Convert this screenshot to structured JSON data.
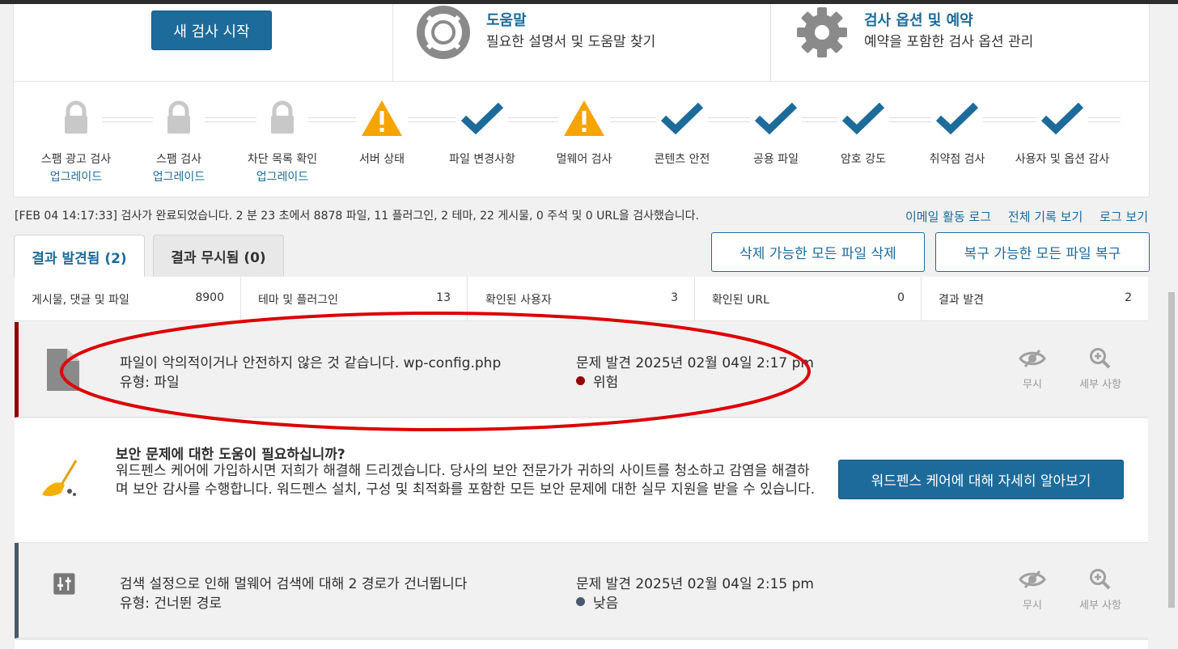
{
  "top": {
    "new_scan_label": "새 검사 시작",
    "help": {
      "title": "도움말",
      "subtitle": "필요한 설명서 및 도움말 찾기"
    },
    "options": {
      "title": "검사 옵션 및 예약",
      "subtitle": "예약을 포함한 검사 옵션 관리"
    }
  },
  "steps": [
    {
      "label": "스팸 광고 검사",
      "upgrade": "업그레이드",
      "status": "locked"
    },
    {
      "label": "스팸 검사",
      "upgrade": "업그레이드",
      "status": "locked"
    },
    {
      "label": "차단 목록 확인",
      "upgrade": "업그레이드",
      "status": "locked"
    },
    {
      "label": "서버 상태",
      "status": "warning"
    },
    {
      "label": "파일 변경사항",
      "status": "ok"
    },
    {
      "label": "멀웨어 검사",
      "status": "warning"
    },
    {
      "label": "콘텐츠 안전",
      "status": "ok"
    },
    {
      "label": "공용 파일",
      "status": "ok"
    },
    {
      "label": "암호 강도",
      "status": "ok"
    },
    {
      "label": "취약점 검사",
      "status": "ok"
    },
    {
      "label": "사용자 및 옵션 감사",
      "status": "ok"
    }
  ],
  "summary": "[FEB 04 14:17:33] 검사가 완료되었습니다. 2 분 23 초에서 8878 파일, 11 플러그인, 2 테마, 22 게시물, 0 주석 및 0 URL을 검사했습니다.",
  "log_links": {
    "email": "이메일 활동 로그",
    "full": "전체 기록 보기",
    "log": "로그 보기"
  },
  "tabs": {
    "found": "결과 발견됨 (2)",
    "ignored": "결과 무시됨 (0)"
  },
  "actions": {
    "delete_all": "삭제 가능한 모든 파일 삭제",
    "repair_all": "복구 가능한 모든 파일 복구"
  },
  "stats": [
    {
      "label": "게시물, 댓글 및 파일",
      "value": "8900"
    },
    {
      "label": "테마 및 플러그인",
      "value": "13"
    },
    {
      "label": "확인된 사용자",
      "value": "3"
    },
    {
      "label": "확인된 URL",
      "value": "0"
    },
    {
      "label": "결과 발견",
      "value": "2"
    }
  ],
  "issues": [
    {
      "title": "파일이 악의적이거나 안전하지 않은 것 같습니다. wp-config.php",
      "type": "유형: 파일",
      "found": "문제 발견 2025년 02월 04일 2:17 pm",
      "severity": "위험",
      "severity_color": "#930000",
      "ignore": "무시",
      "details": "세부 사항"
    },
    {
      "title": "검색 설정으로 인해 멀웨어 검색에 대해 2 경로가 건너뜁니다",
      "type": "유형: 건너뛴 경로",
      "found": "문제 발견 2025년 02월 04일 2:15 pm",
      "severity": "낮음",
      "severity_color": "#49586a",
      "ignore": "무시",
      "details": "세부 사항"
    }
  ],
  "help_box": {
    "heading": "보안 문제에 대한 도움이 필요하십니까?",
    "body": "워드펜스 케어에 가입하시면 저희가 해결해 드리겠습니다. 당사의 보안 전문가가 귀하의 사이트를 청소하고 감염을 해결하며 보안 감사를 수행합니다. 워드펜스 설치, 구성 및 최적화를 포함한 모든 보안 문제에 대한 실무 지원을 받을 수 있습니다.",
    "button": "워드펜스 케어에 대해 자세히 알아보기"
  },
  "colors": {
    "accent": "#1d6b9a",
    "warning": "#f6a400",
    "critical": "#930000",
    "low": "#49586a",
    "annotation": "#dd0000"
  }
}
